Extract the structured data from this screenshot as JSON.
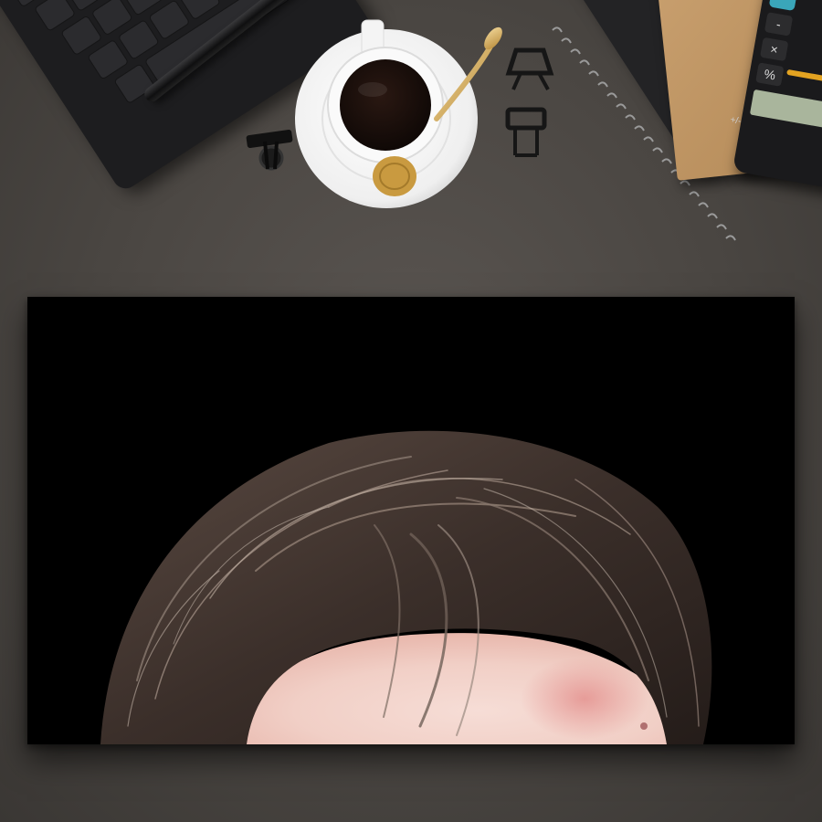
{
  "scene": {
    "desk_color": "#4a4642",
    "picture_background": "#000000",
    "hair_color": "#3b2f2a",
    "skin_color": "#f1cfc6",
    "coffee_color": "#1a100c",
    "spoon_color": "#d7b56a"
  },
  "calculator": {
    "keys": [
      "+",
      "-",
      "×",
      "%",
      "+/-"
    ]
  }
}
